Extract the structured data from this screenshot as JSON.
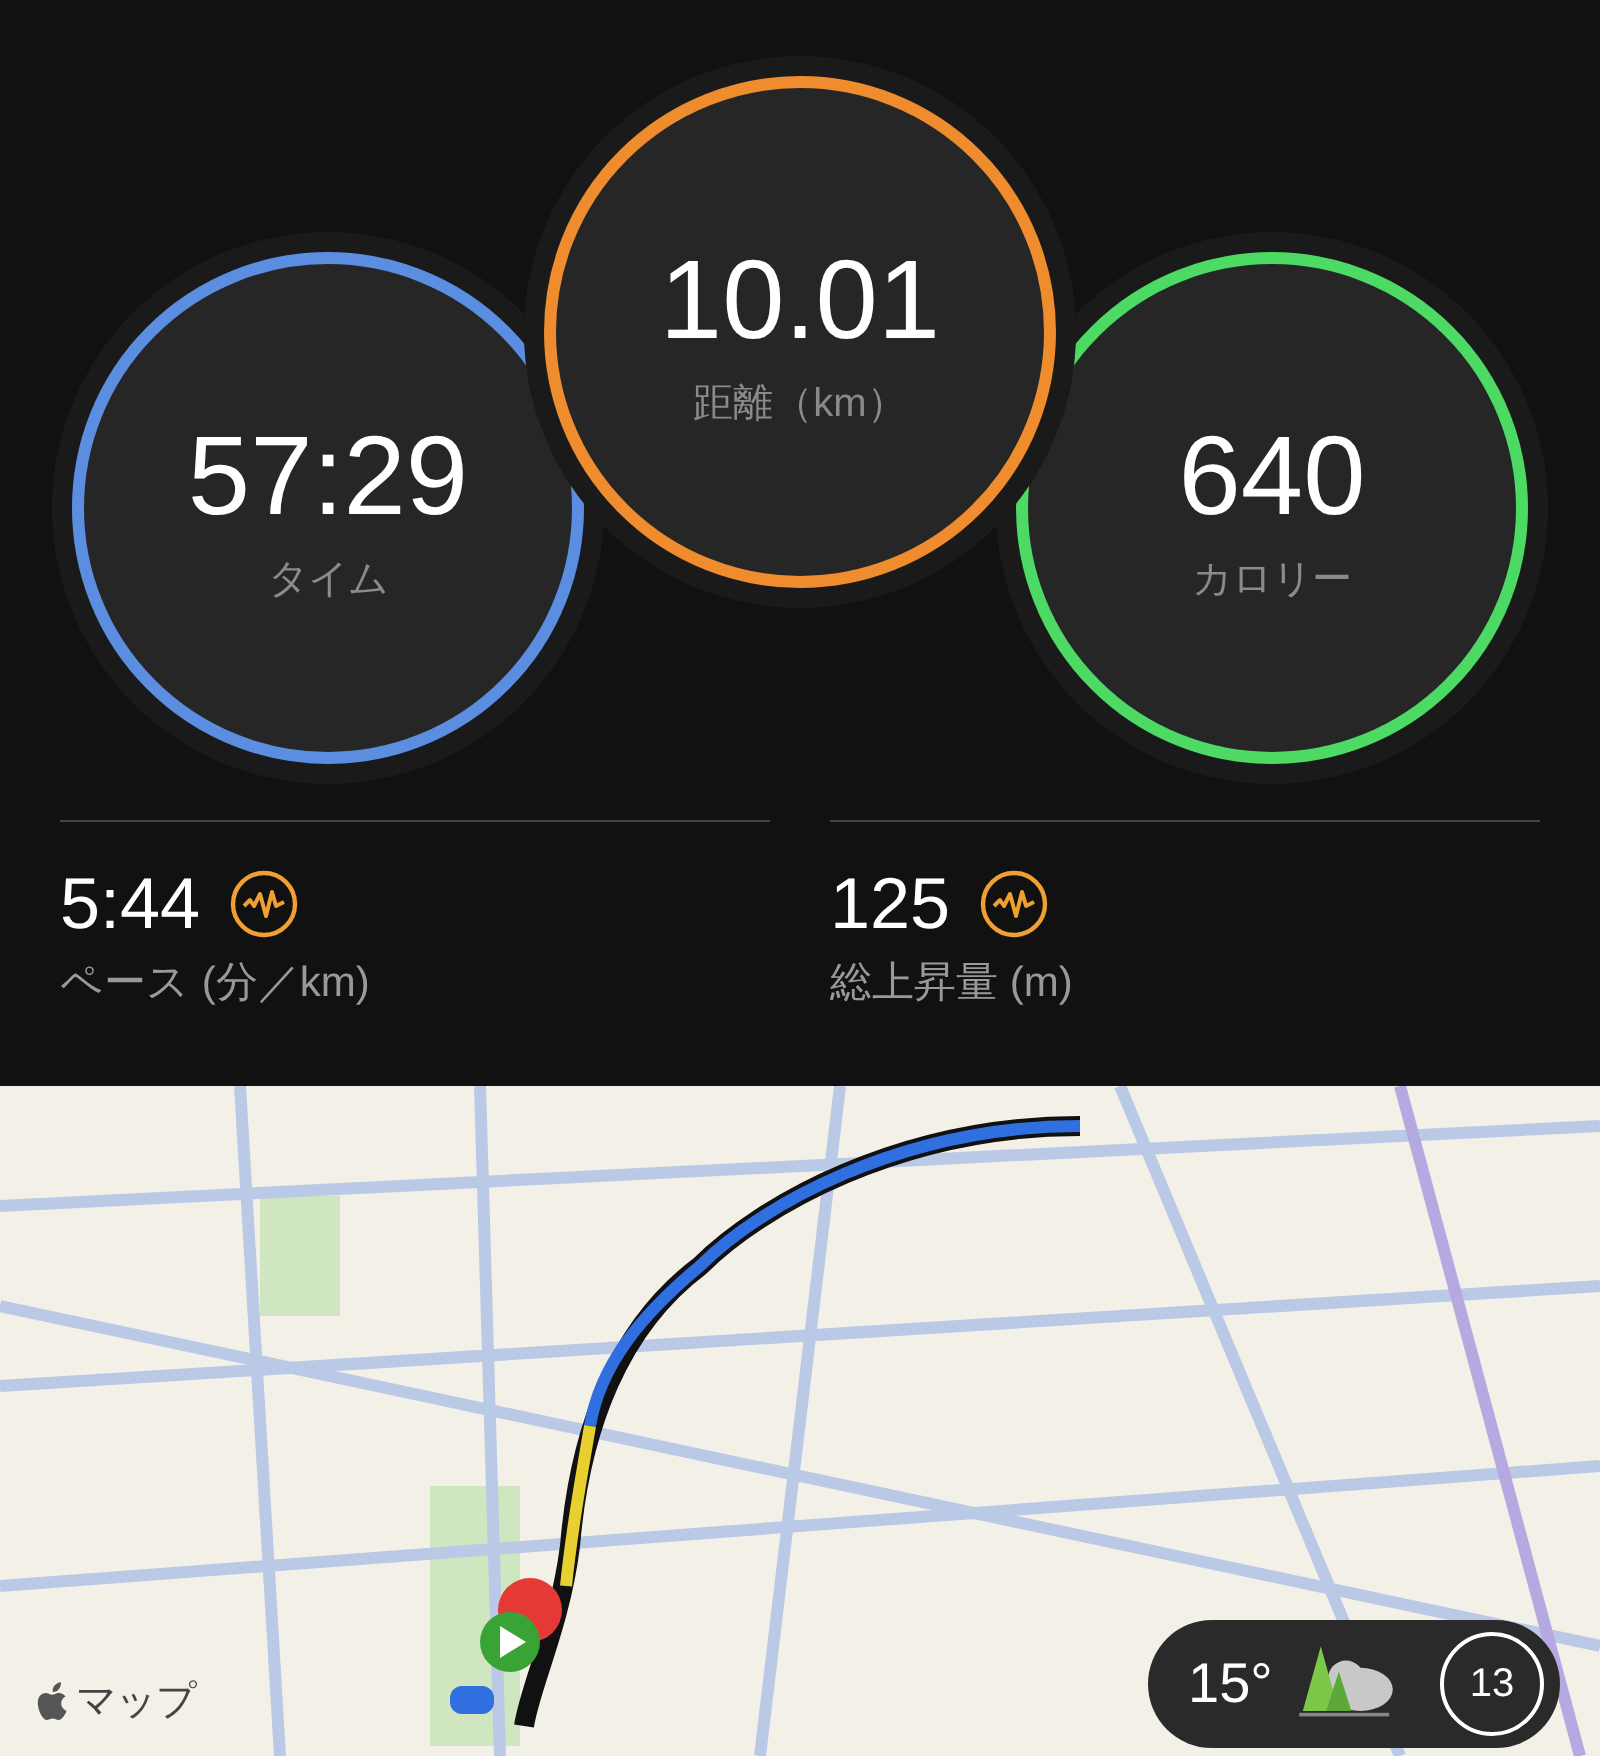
{
  "rings": [
    {
      "value": "57:29",
      "label": "タイム",
      "color": "#5b8ee0"
    },
    {
      "value": "10.01",
      "label": "距離（km）",
      "color": "#ef8d2e"
    },
    {
      "value": "640",
      "label": "カロリー",
      "color": "#4cd964"
    }
  ],
  "stats": [
    {
      "value": "5:44",
      "label": "ペース (分／km)"
    },
    {
      "value": "125",
      "label": "総上昇量 (m)"
    }
  ],
  "map": {
    "kind": "picture",
    "attribution": "マップ",
    "weather": {
      "temperature": "15°",
      "index": "13"
    }
  }
}
